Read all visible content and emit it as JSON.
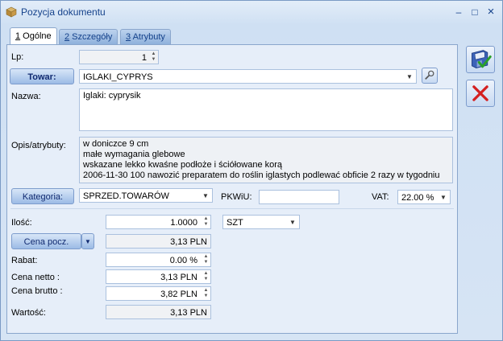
{
  "window": {
    "title": "Pozycja dokumentu",
    "minimize": "–",
    "maximize": "□",
    "close": "×"
  },
  "tabs": [
    {
      "num": "1",
      "label": " Ogólne"
    },
    {
      "num": "2",
      "label": " Szczegóły"
    },
    {
      "num": "3",
      "label": " Atrybuty"
    }
  ],
  "form": {
    "lp_label": "Lp:",
    "lp_value": "1",
    "towar_button": "Towar:",
    "towar_value": "IGLAKI_CYPRYS",
    "nazwa_label": "Nazwa:",
    "nazwa_value": "Iglaki: cyprysik",
    "opis_label": "Opis/atrybuty:",
    "opis_lines": [
      "w doniczce 9 cm",
      "małe wymagania glebowe",
      "wskazane lekko kwaśne podłoże i ściółowane korą",
      "2006-11-30 100 nawozić preparatem do roślin iglastych podlewać obficie 2 razy w tygodniu"
    ],
    "kategoria_button": "Kategoria:",
    "kategoria_value": "SPRZED.TOWARÓW",
    "pkwiu_label": "PKWiU:",
    "pkwiu_value": "",
    "vat_label": "VAT:",
    "vat_value": "22.00 %"
  },
  "pricing": {
    "ilosc_label": "Ilość:",
    "ilosc_value": "1.0000",
    "unit_value": "SZT",
    "cena_pocz_button": "Cena pocz.",
    "cena_pocz_value": "3,13 PLN",
    "rabat_label": "Rabat:",
    "rabat_value": "0.00 %",
    "cena_netto_label": "Cena netto :",
    "cena_netto_value": "3,13 PLN",
    "cena_brutto_label": "Cena brutto :",
    "cena_brutto_value": "3,82 PLN",
    "wartosc_label": "Wartość:",
    "wartosc_value": "3,13 PLN"
  },
  "icons": {
    "app": "box-icon",
    "save": "save-disk-check-icon",
    "cancel": "red-x-icon",
    "towar_lookup": "magnifier-icon"
  },
  "colors": {
    "accent": "#15428b",
    "cancel_red": "#d42020",
    "check_green": "#2aa02a"
  }
}
